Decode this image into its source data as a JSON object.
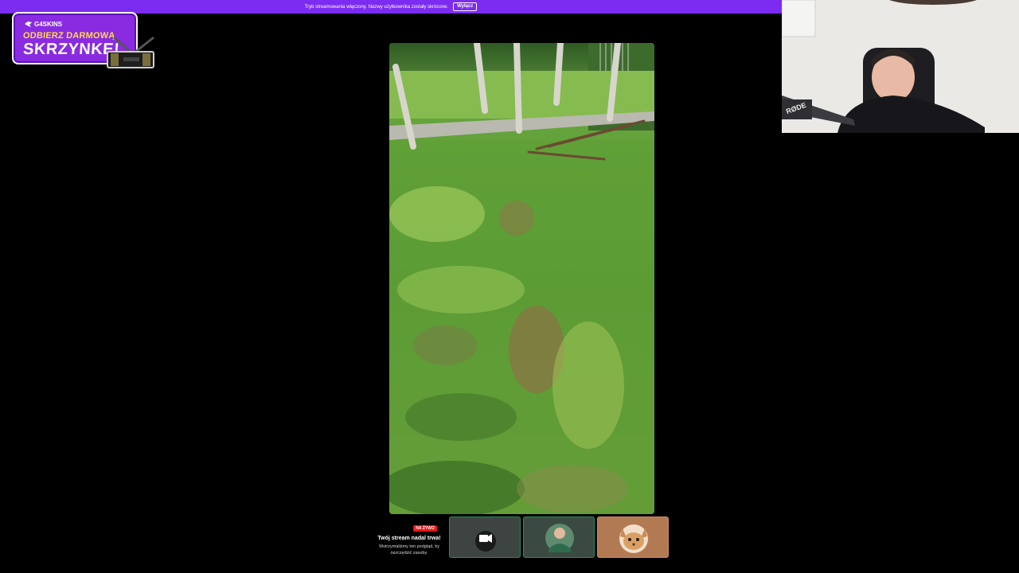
{
  "banner": {
    "message": "Tryb streamowania włączony. Nazwy użytkownika zostały skrócone.",
    "button_label": "Wyłącz"
  },
  "promo": {
    "brand": "G4SKINS",
    "line1": "ODBIERZ DARMOWĄ",
    "line2": "SKRZYNKĘ!"
  },
  "stream_status": {
    "live_badge": "NA ŻYWO",
    "title": "Twój stream nadal trwa!",
    "description": "Wstrzymaliśmy ten podgląd, by oszczędzić zasoby."
  },
  "webcam": {
    "mic_brand": "RØDE"
  },
  "colors": {
    "banner_bg": "#7b2cf0",
    "live_red": "#e91916",
    "promo_purple": "#8a2be2",
    "promo_yellow": "#ffd84a"
  },
  "tiles": [
    {
      "icon": "camera-icon"
    },
    {
      "icon": "avatar-person"
    },
    {
      "icon": "avatar-cat"
    }
  ]
}
